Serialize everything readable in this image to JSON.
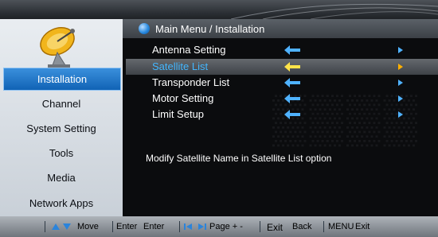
{
  "header": {
    "breadcrumb": "Main Menu / Installation"
  },
  "sidebar": {
    "items": [
      {
        "label": "Installation",
        "active": true
      },
      {
        "label": "Channel",
        "active": false
      },
      {
        "label": "System Setting",
        "active": false
      },
      {
        "label": "Tools",
        "active": false
      },
      {
        "label": "Media",
        "active": false
      },
      {
        "label": "Network Apps",
        "active": false
      }
    ]
  },
  "menu": {
    "items": [
      {
        "label": "Antenna Setting",
        "selected": false
      },
      {
        "label": "Satellite List",
        "selected": true
      },
      {
        "label": "Transponder List",
        "selected": false
      },
      {
        "label": "Motor Setting",
        "selected": false
      },
      {
        "label": "Limit Setup",
        "selected": false
      }
    ],
    "hint": "Modify Satellite Name in Satellite List option"
  },
  "footer": {
    "move_label": "Move",
    "enter_key": "Enter",
    "enter_label": "Enter",
    "page_label": "Page + -",
    "exit_key": "Exit",
    "back_label": "Back",
    "menu_key": "MENU",
    "exit_label": "Exit"
  },
  "colors": {
    "accent": "#1f74c8",
    "selected_text": "#43b6ff",
    "arrow_normal": "#4fb2ff",
    "arrow_selected": "#ffe34a",
    "arrow_right": "#ffb000"
  }
}
